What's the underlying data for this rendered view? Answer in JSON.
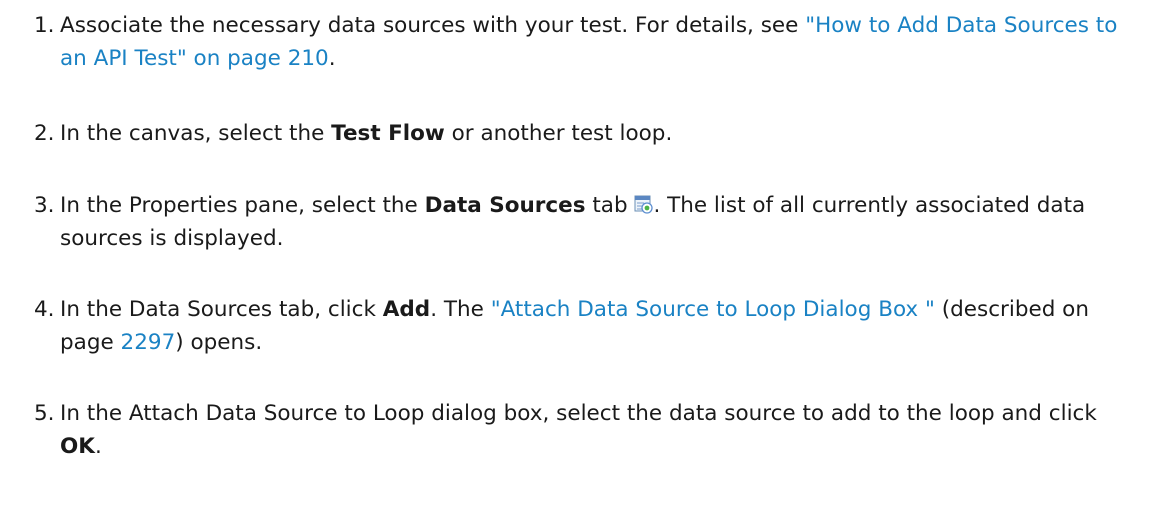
{
  "steps": [
    {
      "number": "1.",
      "text_before": "Associate the necessary data sources with your test. For details, see ",
      "link": "\"How to Add Data Sources to an API Test\" on page 210",
      "text_after": "."
    },
    {
      "number": "2.",
      "text_before": "In the canvas, select the ",
      "bold": "Test Flow",
      "text_after": " or another test loop."
    },
    {
      "number": "3.",
      "text_before": "In the Properties pane, select the ",
      "bold": "Data Sources",
      "text_mid": " tab ",
      "icon": "data-sources-tab-icon",
      "text_after": ". The list of all currently associated data sources is displayed."
    },
    {
      "number": "4.",
      "text_before": "In the Data Sources tab, click ",
      "bold": "Add",
      "text_mid": ". The ",
      "link": "\"Attach Data Source to Loop Dialog Box \"",
      "text_mid2": " (described on page ",
      "link_page": "2297",
      "text_after": ") opens."
    },
    {
      "number": "5.",
      "text_before": "In the Attach Data Source to Loop dialog box, select the data source to add to the loop and click ",
      "bold": "OK",
      "text_after": "."
    }
  ],
  "colors": {
    "link": "#1a82c4",
    "text": "#1a1a1a"
  }
}
